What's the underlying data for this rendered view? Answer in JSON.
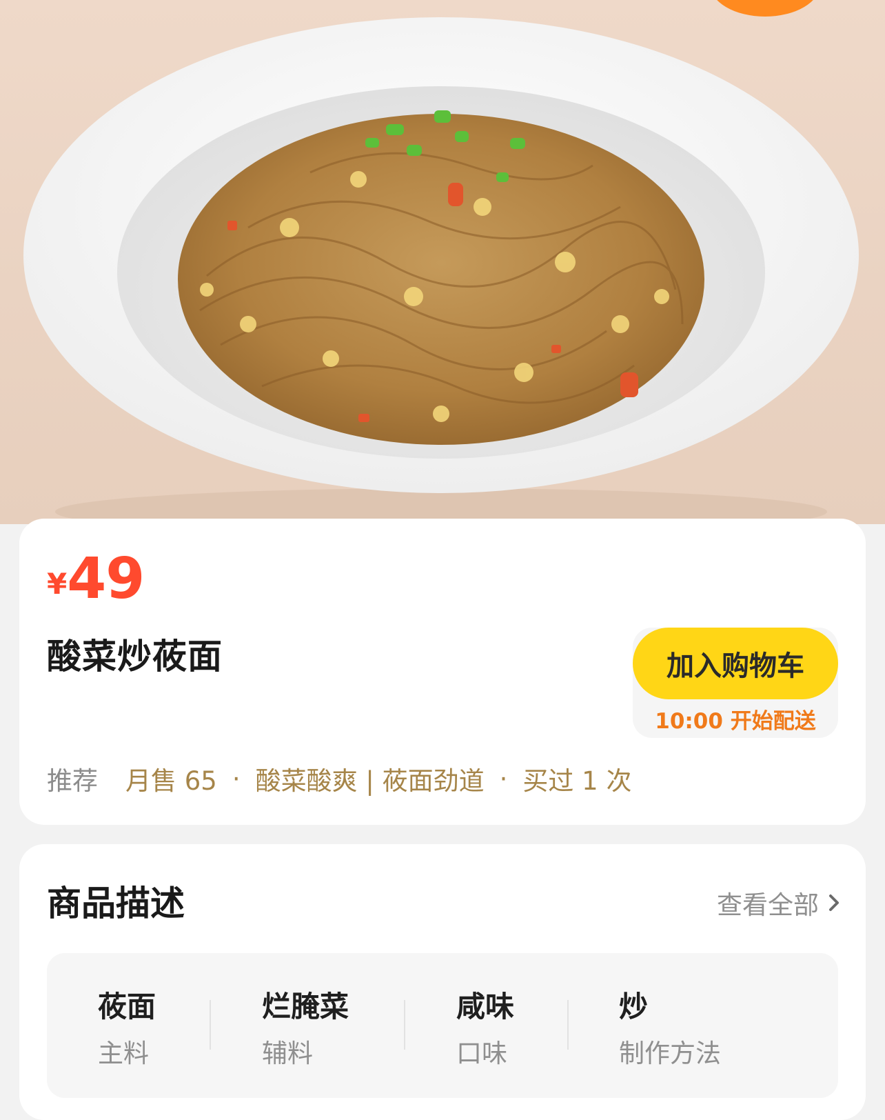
{
  "product": {
    "currency": "¥",
    "price": "49",
    "name": "酸菜炒莜面"
  },
  "cart": {
    "button_label": "加入购物车",
    "delivery_note": "10:00 开始配送"
  },
  "meta": {
    "recommend": "推荐",
    "monthly_sales": "月售 65",
    "tags": "酸菜酸爽 | 莜面劲道",
    "bought": "买过 1 次"
  },
  "description": {
    "title": "商品描述",
    "view_all": "查看全部",
    "attributes": [
      {
        "value": "莜面",
        "label": "主料"
      },
      {
        "value": "烂腌菜",
        "label": "辅料"
      },
      {
        "value": "咸味",
        "label": "口味"
      },
      {
        "value": "炒",
        "label": "制作方法"
      }
    ]
  },
  "colors": {
    "price_red": "#ff4a2e",
    "cart_yellow": "#ffd616",
    "delivery_orange": "#f07a1a",
    "meta_gold": "#a68549"
  },
  "icons": {
    "view_all": "chevron-right-icon"
  }
}
